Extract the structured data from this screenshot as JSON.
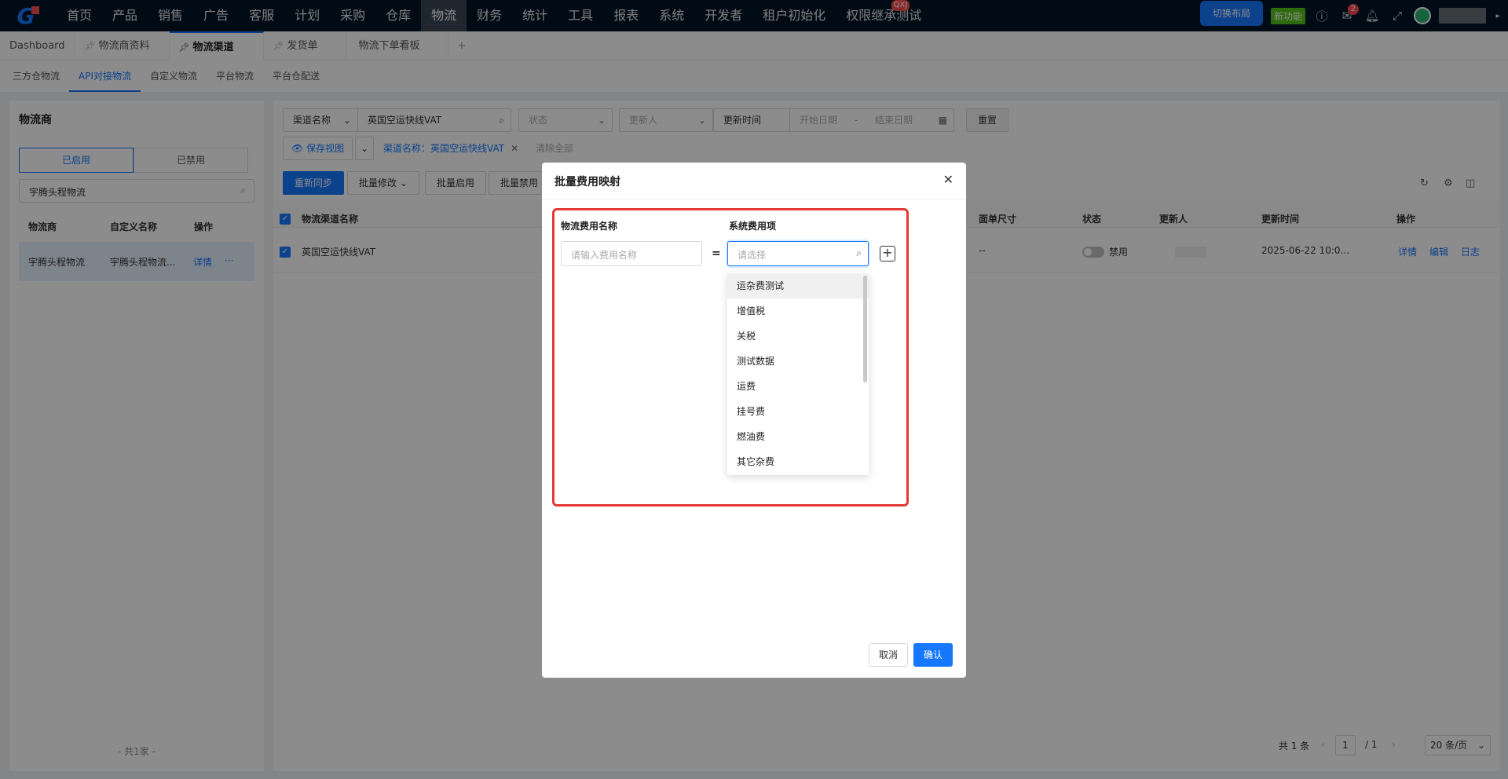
{
  "nav": {
    "logo": "G",
    "items": [
      "首页",
      "产品",
      "销售",
      "广告",
      "客服",
      "计划",
      "采购",
      "仓库",
      "物流",
      "财务",
      "统计",
      "工具",
      "报表",
      "系统",
      "开发者",
      "租户初始化",
      "权限继承测试"
    ],
    "active_index": 8,
    "badge_label": "QXJ",
    "switch_layout": "切换布局",
    "new_feature": "新功能",
    "task_badge": "2"
  },
  "page_tabs": [
    {
      "label": "Dashboard"
    },
    {
      "label": "物流商资料"
    },
    {
      "label": "物流渠道"
    },
    {
      "label": "发货单"
    },
    {
      "label": "物流下单看板"
    },
    {
      "label": "+"
    }
  ],
  "sub_tabs": [
    "三方仓物流",
    "API对接物流",
    "自定义物流",
    "平台物流",
    "平台仓配送"
  ],
  "left": {
    "title": "物流商",
    "seg_enabled": "已启用",
    "seg_disabled": "已禁用",
    "search_value": "宇腾头程物流",
    "col_provider": "物流商",
    "col_custom": "自定义名称",
    "col_action": "操作",
    "row_provider": "宇腾头程物流",
    "row_custom": "宇腾头程物流...",
    "row_detail": "详情",
    "row_more": "···",
    "footer": "- 共1家 -"
  },
  "right": {
    "filter_channel_label": "渠道名称",
    "filter_channel_value": "英国空运快线VAT",
    "filter_status": "状态",
    "filter_updater": "更新人",
    "filter_time_label": "更新时间",
    "filter_start": "开始日期",
    "filter_sep": "-",
    "filter_end": "结束日期",
    "reset": "重置",
    "save_view": "保存视图",
    "active_tag": "渠道名称：英国空运快线VAT",
    "clear_all": "清除全部",
    "btn_resync": "重新同步",
    "btn_batch_edit": "批量修改",
    "btn_batch_enable": "批量启用",
    "btn_batch_disable": "批量禁用",
    "col_name": "物流渠道名称",
    "col_size": "面单尺寸",
    "col_status": "状态",
    "col_updater": "更新人",
    "col_time": "更新时间",
    "col_action": "操作",
    "row_name": "英国空运快线VAT",
    "row_size": "--",
    "row_status": "禁用",
    "row_time": "2025-06-22 10:0...",
    "row_detail": "详情",
    "row_edit": "编辑",
    "row_log": "日志",
    "total": "共 1 条",
    "page_current": "1",
    "page_total": "/ 1",
    "page_size": "20 条/页"
  },
  "modal": {
    "title": "批量费用映射",
    "col_logistics_fee": "物流费用名称",
    "col_system_fee": "系统费用项",
    "fee_placeholder": "请输入费用名称",
    "equals": "=",
    "select_placeholder": "请选择",
    "options": [
      "运杂费测试",
      "增值税",
      "关税",
      "测试数据",
      "运费",
      "挂号费",
      "燃油费",
      "其它杂费"
    ],
    "cancel": "取消",
    "confirm": "确认"
  },
  "colors": {
    "primary": "#1677ff",
    "nav_bg": "#001529",
    "highlight_box": "#e53935"
  }
}
